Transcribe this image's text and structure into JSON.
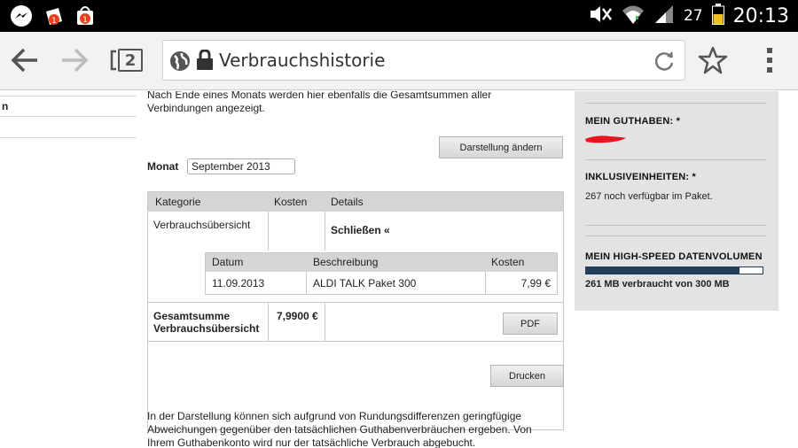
{
  "status_bar": {
    "battery_pct": "27",
    "time": "20:13",
    "icons": [
      "messenger-icon",
      "shopping-bag-icon",
      "shopping-bag-icon",
      "mute-icon",
      "wifi-icon",
      "signal-icon",
      "battery-icon"
    ],
    "badges": [
      "1",
      "1"
    ]
  },
  "browser": {
    "tab_count": "2",
    "url_title": "Verbrauchshistorie"
  },
  "page": {
    "intro": "Nach Ende eines Monats werden hier ebenfalls die Gesamtsummen aller Verbindungen angezeigt.",
    "leftnav_item": "n",
    "darstellung_button": "Darstellung ändern",
    "monat_label": "Monat",
    "monat_value": "September 2013",
    "table": {
      "headers": [
        "Kategorie",
        "Kosten",
        "Details"
      ],
      "category": "Verbrauchsübersicht",
      "close_link": "Schließen «",
      "inner_headers": [
        "Datum",
        "Beschreibung",
        "Kosten"
      ],
      "inner_row": {
        "date": "11.09.2013",
        "description": "ALDI TALK Paket 300",
        "cost": "7,99 €"
      },
      "total_label_line1": "Gesamtsumme",
      "total_label_line2": "Verbrauchsübersicht",
      "total_value": "7,9900 €",
      "pdf_button": "PDF"
    },
    "print_button": "Drucken",
    "footnote": "In der Darstellung können sich aufgrund von Rundungsdifferenzen geringfügige Abweichungen gegenüber den tatsächlichen Guthabenverbräuchen ergeben. Von Ihrem Guthabenkonto wird nur der tatsächliche Verbrauch abgebucht."
  },
  "sidebar": {
    "guthaben_title": "MEIN GUTHABEN: *",
    "inklusiv_title": "INKLUSIVEINHEITEN: *",
    "inklusiv_text": "267 noch verfügbar im Paket.",
    "datenvolumen_title": "MEIN HIGH-SPEED DATENVOLUMEN",
    "datenvolumen_text": "261 MB verbraucht von 300 MB",
    "datenvolumen_fraction": 0.87
  },
  "colors": {
    "accent_bar": "#233f5c",
    "redaction": "#e8141e"
  }
}
